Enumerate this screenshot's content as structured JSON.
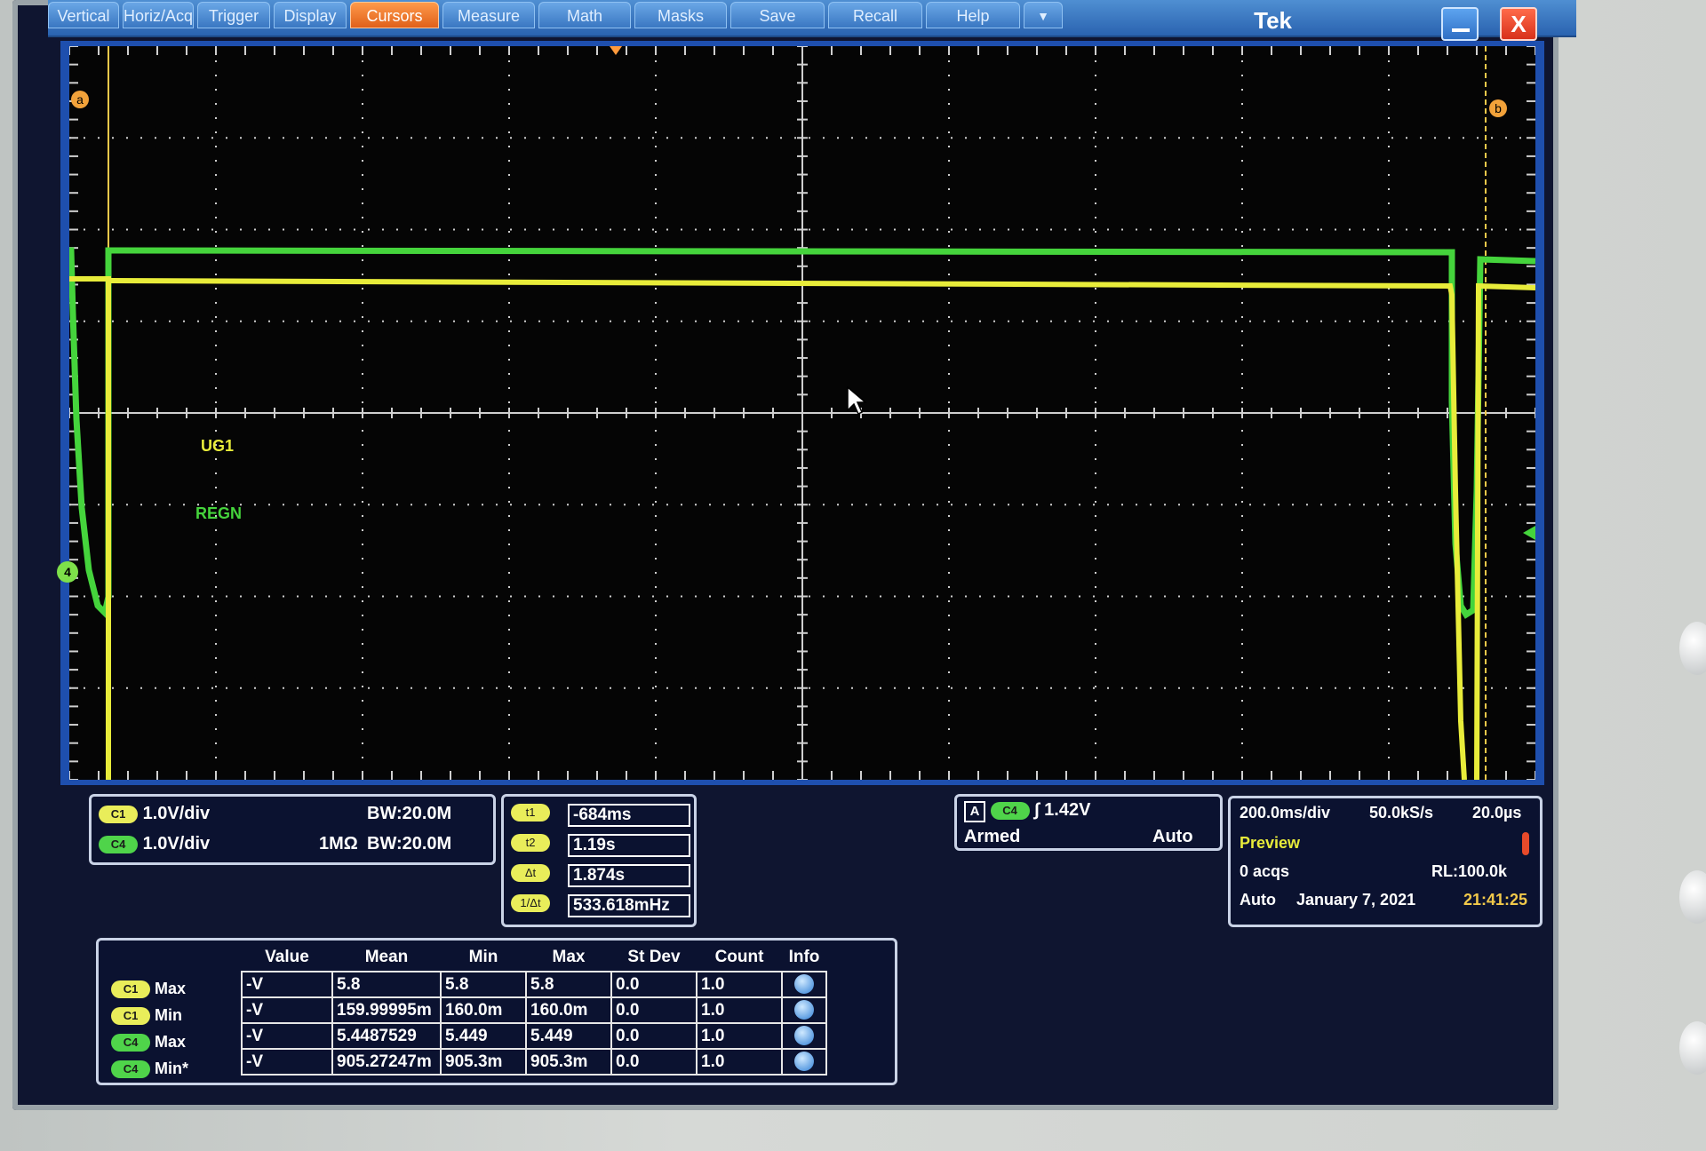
{
  "menu": {
    "items": [
      "Vertical",
      "Horiz/Acq",
      "Trigger",
      "Display",
      "Cursors",
      "Measure",
      "Math",
      "Masks",
      "Save",
      "Recall",
      "Help"
    ],
    "active": "Cursors",
    "more_glyph": "▼",
    "brand": "Tek",
    "close_glyph": "X"
  },
  "graticule": {
    "cursor_a_label": "a",
    "cursor_b_label": "b",
    "ch4_marker": "4",
    "label_ug1": "UG1",
    "label_regn": "REGN"
  },
  "channels": {
    "c1_badge": "C1",
    "c1_scale": "1.0V/div",
    "c1_bw": "BW:20.0M",
    "c4_badge": "C4",
    "c4_scale": "1.0V/div",
    "c4_impedance": "1MΩ",
    "c4_bw": "BW:20.0M"
  },
  "cursors": {
    "rows": [
      {
        "label": "t1",
        "value": "-684ms"
      },
      {
        "label": "t2",
        "value": "1.19s"
      },
      {
        "label": "Δt",
        "value": "1.874s"
      },
      {
        "label": "1/Δt",
        "value": "533.618mHz"
      }
    ]
  },
  "trigger": {
    "mode_letter": "A",
    "source": "C4",
    "level": "1.42V",
    "state": "Armed",
    "mode": "Auto"
  },
  "acquisition": {
    "timebase": "200.0ms/div",
    "sample_rate": "50.0kS/s",
    "resolution": "20.0µs",
    "status": "Preview",
    "acqs": "0 acqs",
    "record_length": "RL:100.0k",
    "auto": "Auto",
    "date": "January 7, 2021",
    "time": "21:41:25"
  },
  "measurements": {
    "headers": [
      "Value",
      "Mean",
      "Min",
      "Max",
      "St Dev",
      "Count",
      "Info"
    ],
    "rows": [
      {
        "badge": "C1",
        "label": "Max",
        "value": "-V",
        "mean": "5.8",
        "min": "5.8",
        "max": "5.8",
        "stdev": "0.0",
        "count": "1.0"
      },
      {
        "badge": "C1",
        "label": "Min",
        "value": "-V",
        "mean": "159.99995m",
        "min": "160.0m",
        "max": "160.0m",
        "stdev": "0.0",
        "count": "1.0"
      },
      {
        "badge": "C4",
        "label": "Max",
        "value": "-V",
        "mean": "5.4487529",
        "min": "5.449",
        "max": "5.449",
        "stdev": "0.0",
        "count": "1.0"
      },
      {
        "badge": "C4",
        "label": "Min*",
        "value": "-V",
        "mean": "905.27247m",
        "min": "905.3m",
        "max": "905.3m",
        "stdev": "0.0",
        "count": "1.0"
      }
    ]
  },
  "colors": {
    "ch1": "#e8ec3a",
    "ch4": "#45d43c",
    "cursor": "#f2c94a"
  }
}
